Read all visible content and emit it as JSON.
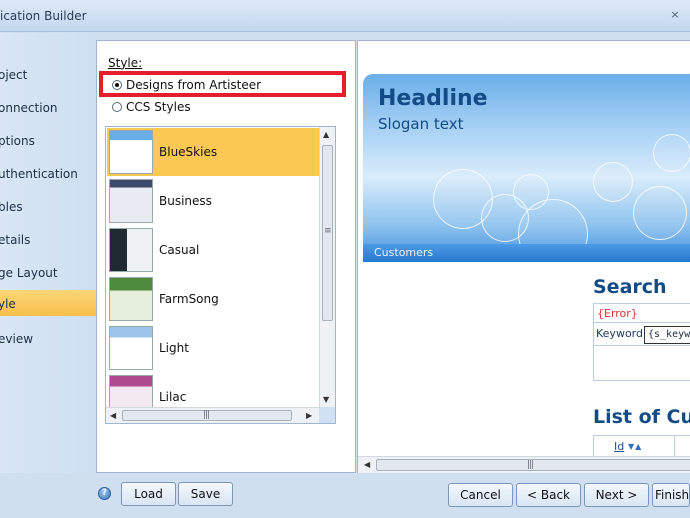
{
  "window": {
    "title": "ication Builder",
    "close_glyph": "×"
  },
  "sidebar": {
    "items": [
      {
        "label": "oject"
      },
      {
        "label": "onnection"
      },
      {
        "label": "ptions"
      },
      {
        "label": "uthentication"
      },
      {
        "label": "bles"
      },
      {
        "label": "etails"
      },
      {
        "label": "ge Layout"
      },
      {
        "label": "yle"
      },
      {
        "label": "eview"
      }
    ]
  },
  "style_panel": {
    "label": "Style:",
    "options": [
      {
        "label": "Designs from Artisteer",
        "selected": true
      },
      {
        "label": "CCS Styles",
        "selected": false
      }
    ],
    "designs": [
      {
        "name": "BlueSkies",
        "selected": true
      },
      {
        "name": "Business"
      },
      {
        "name": "Casual"
      },
      {
        "name": "FarmSong"
      },
      {
        "name": "Light"
      },
      {
        "name": "Lilac"
      }
    ]
  },
  "preview": {
    "headline": "Headline",
    "slogan": "Slogan text",
    "menu": "Customers",
    "search_title": "Search",
    "error": "{Error}",
    "keyword_label": "Keyword",
    "keyword_value": "{s_keyword}",
    "list_title": "List of Customers",
    "column": "Id",
    "sort_glyphs": "▼▲"
  },
  "buttons": {
    "load": "Load",
    "save": "Save",
    "cancel": "Cancel",
    "back": "< Back",
    "next": "Next >",
    "finish": "Finish"
  },
  "colors": {
    "selection": "#fbc953",
    "highlight_border": "#e0202a",
    "headline": "#124b85"
  }
}
